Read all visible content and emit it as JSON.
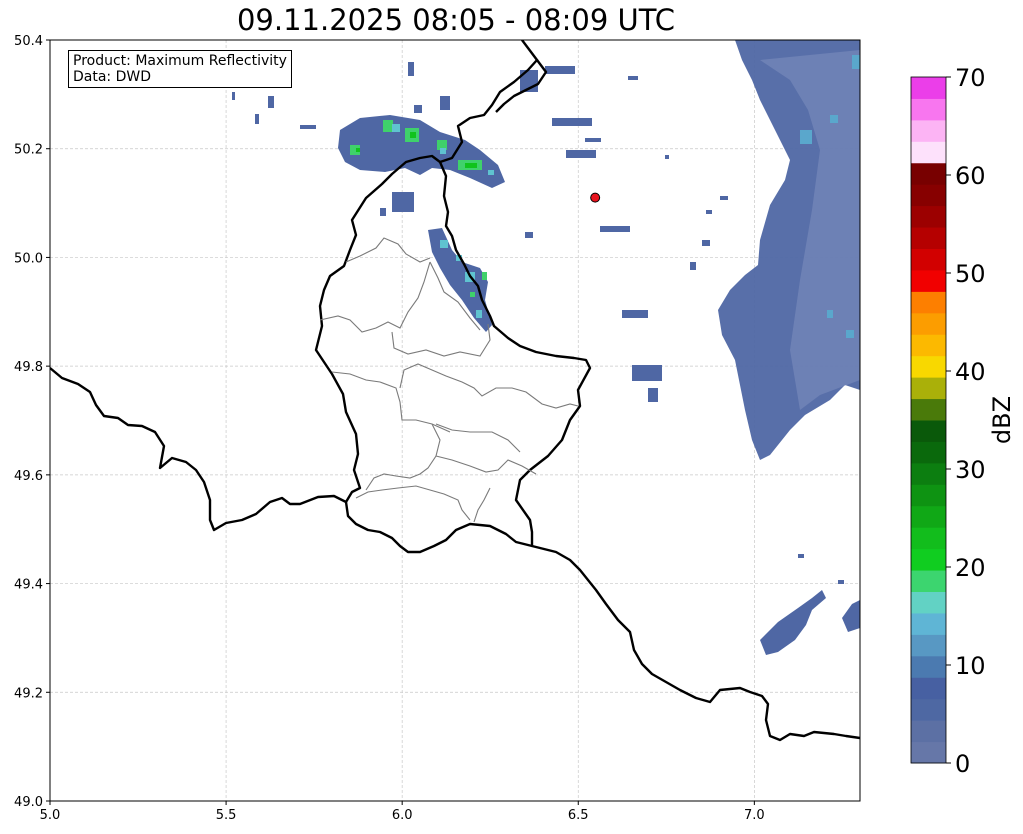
{
  "title": "09.11.2025 08:05 - 08:09 UTC",
  "info": {
    "product": "Product: Maximum Reflectivity",
    "data": "Data: DWD"
  },
  "map": {
    "lon_range": [
      5.0,
      7.3
    ],
    "lat_range": [
      49.0,
      50.4
    ],
    "x_ticks": [
      "5.0",
      "5.5",
      "6.0",
      "6.5",
      "7.0"
    ],
    "y_ticks": [
      "49.0",
      "49.2",
      "49.4",
      "49.6",
      "49.8",
      "50.0",
      "50.2",
      "50.4"
    ],
    "radar_site": {
      "lon": 6.548,
      "lat": 50.11,
      "color": "#e8141e"
    }
  },
  "colorbar": {
    "label": "dBZ",
    "range": [
      0,
      70
    ],
    "tick_labels": [
      "0",
      "10",
      "20",
      "30",
      "40",
      "50",
      "60",
      "70"
    ],
    "colors": [
      "#6677a8",
      "#5c70a4",
      "#4e68a3",
      "#4760a2",
      "#4b7ab0",
      "#5898c3",
      "#5fb5d5",
      "#62d2c4",
      "#3cd56f",
      "#10cd20",
      "#12bd1c",
      "#10a816",
      "#0e9312",
      "#0c7e10",
      "#0a690c",
      "#0a590a",
      "#4a7a0a",
      "#aab009",
      "#f8d800",
      "#fcb900",
      "#fc9d00",
      "#fd7f00",
      "#f10000",
      "#d20000",
      "#b50000",
      "#9c0000",
      "#870000",
      "#780000",
      "#fde1fb",
      "#fcb4f4",
      "#f876ef",
      "#eb3ee9"
    ]
  }
}
